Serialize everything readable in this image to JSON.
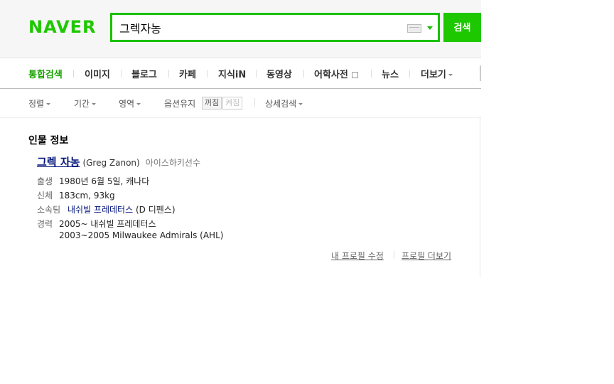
{
  "logo": {
    "text": "NAVER"
  },
  "search": {
    "query": "그렉자농",
    "button_label": "검색"
  },
  "tabs": [
    {
      "label": "통합검색",
      "active": true
    },
    {
      "label": "이미지"
    },
    {
      "label": "블로그"
    },
    {
      "label": "카페"
    },
    {
      "label": "지식iN"
    },
    {
      "label": "동영상"
    },
    {
      "label": "어학사전"
    },
    {
      "label": "뉴스"
    },
    {
      "label": "더보기"
    }
  ],
  "options": {
    "sort": "정렬",
    "period": "기간",
    "area": "영역",
    "keep_option": "옵션유지",
    "toggle_off": "꺼짐",
    "toggle_on": "켜짐",
    "detail": "상세검색"
  },
  "profile": {
    "section_title": "인물 정보",
    "name": "그렉 자농",
    "english_name": "(Greg Zanon)",
    "occupation": "아이스하키선수",
    "birth_label": "출생",
    "birth_value": "1980년 6월 5일, 캐나다",
    "body_label": "신체",
    "body_value": "183cm, 93kg",
    "team_label": "소속팀",
    "team_name": "내쉬빌 프레데터스",
    "team_position": "(D 디펜스)",
    "career_label": "경력",
    "career_1": "2005~ 내쉬빌 프레데터스",
    "career_2": "2003~2005 Milwaukee Admirals (AHL)",
    "edit_link": "내 프로필 수정",
    "more_link": "프로필 더보기"
  }
}
